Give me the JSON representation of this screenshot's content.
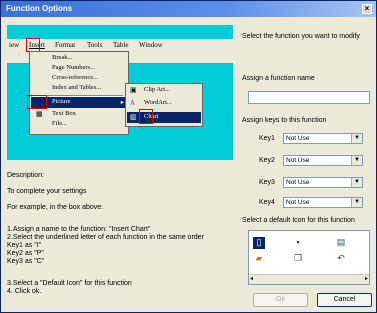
{
  "window": {
    "title": "Function Options",
    "close": "×"
  },
  "preview": {
    "menubar": [
      "iew",
      "Insert",
      "Format",
      "Tools",
      "Table",
      "Window"
    ],
    "insert_menu": [
      "Break...",
      "Page Numbers...",
      "Cross-reference...",
      "Index and Tables...",
      "Picture",
      "Text Box",
      "File..."
    ],
    "picture_submenu": [
      "Clip Art...",
      "WordArt...",
      "Chart"
    ]
  },
  "description": {
    "heading": "Description:",
    "line1": "To complete your settings",
    "line2": "For example, in the box above:",
    "steps": [
      "1.Assign a name to the function: \"Insert Chart\"",
      "2.Select the underlined letter of each function in the same order",
      "Key1 as \"I\"",
      "Key2 as \"P\"",
      "Key3 as \"C\"",
      "",
      "3.Select a \"Default Icon\" for this function",
      "4. Click ok."
    ]
  },
  "right": {
    "select_function": "Select the function you want to modify",
    "assign_name_label": "Assign a function name",
    "assign_name_value": "",
    "assign_keys_label": "Assign keys to this function",
    "keys": [
      {
        "label": "Key1",
        "value": "Not Use"
      },
      {
        "label": "Key2",
        "value": "Not Use"
      },
      {
        "label": "Key3",
        "value": "Not Use"
      },
      {
        "label": "Key4",
        "value": "Not Use"
      }
    ],
    "icon_label": "Select a default  Icon for this function"
  },
  "buttons": {
    "ok": "Ok",
    "cancel": "Cancel"
  },
  "colors": {
    "title_bg": "#3a6fd8",
    "preview_bg": "#00ccd8",
    "highlight": "#0a246a",
    "marker": "#e00000"
  }
}
